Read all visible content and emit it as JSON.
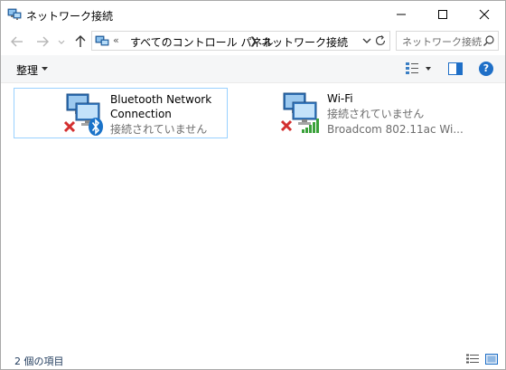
{
  "window": {
    "title": "ネットワーク接続"
  },
  "address": {
    "overflow": "«",
    "segments": [
      "すべてのコントロール パネル",
      "ネットワーク接続"
    ],
    "search_placeholder": "ネットワーク接続"
  },
  "toolbar": {
    "organize_label": "整理"
  },
  "items": [
    {
      "name_line1": "Bluetooth Network",
      "name_line2": "Connection",
      "status": "接続されていません",
      "icon": "bluetooth-network-adapter-icon",
      "selected": true
    },
    {
      "name_line1": "Wi-Fi",
      "status": "接続されていません",
      "device": "Broadcom 802.11ac Wi...",
      "icon": "wifi-network-adapter-icon",
      "selected": false
    }
  ],
  "statusbar": {
    "count_text": "2 個の項目"
  },
  "colors": {
    "accent": "#1f6fc7",
    "selection_border": "#99d1ff",
    "error_x": "#d32f2f",
    "signal_green": "#3aa13a"
  }
}
